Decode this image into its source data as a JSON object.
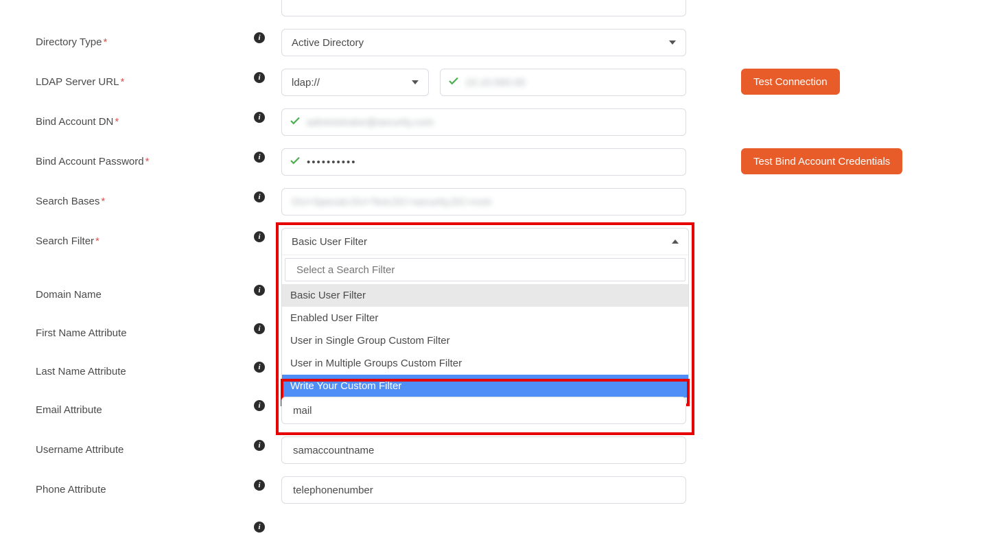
{
  "labels": {
    "directory_type": "Directory Type",
    "ldap_url": "LDAP Server URL",
    "bind_dn": "Bind Account DN",
    "bind_pw": "Bind Account Password",
    "search_bases": "Search Bases",
    "search_filter": "Search Filter",
    "domain_name": "Domain Name",
    "first_name_attr": "First Name Attribute",
    "last_name_attr": "Last Name Attribute",
    "email_attr": "Email Attribute",
    "username_attr": "Username Attribute",
    "phone_attr": "Phone Attribute"
  },
  "values": {
    "directory_type": "Active Directory",
    "ldap_scheme": "ldap://",
    "ldap_host_hidden": "10.10.000.00",
    "bind_dn_hidden": "administrator@security.com",
    "bind_pw_masked": "••••••••••",
    "search_bases_hidden": "OU=Special,OU=Test,DC=security,DC=com",
    "search_filter_selected": "Basic User Filter",
    "email_attr": "mail",
    "username_attr": "samaccountname",
    "phone_attr": "telephonenumber"
  },
  "dropdown": {
    "search_placeholder": "Select a Search Filter",
    "options": [
      "Basic User Filter",
      "Enabled User Filter",
      "User in Single Group Custom Filter",
      "User in Multiple Groups Custom Filter",
      "Write Your Custom Filter"
    ],
    "selected_index": 0,
    "highlighted_index": 4
  },
  "buttons": {
    "test_connection": "Test Connection",
    "test_bind": "Test Bind Account Credentials"
  }
}
